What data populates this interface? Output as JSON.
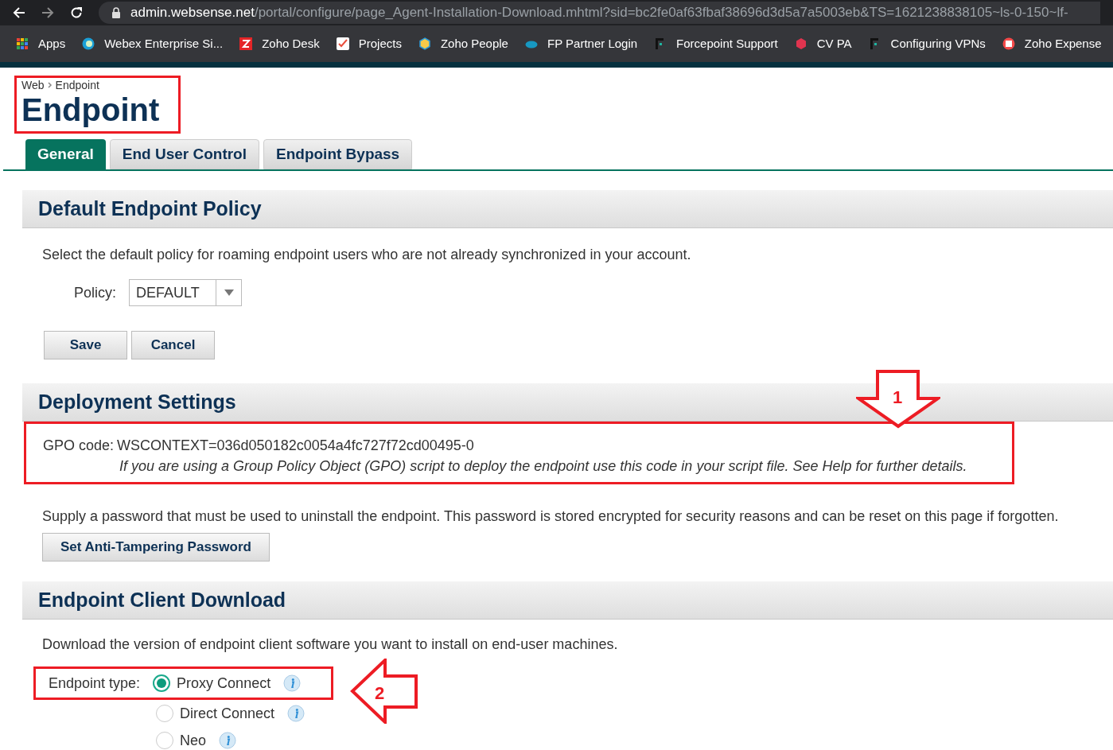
{
  "browser": {
    "url_host": "admin.websense.net",
    "url_path": "/portal/configure/page_Agent-Installation-Download.mhtml?sid=bc2fe0af63fbaf38696d3d5a7a5003eb&TS=1621238838105~ls-0-150~lf-",
    "bookmarks": [
      {
        "label": "Apps"
      },
      {
        "label": "Webex Enterprise Si..."
      },
      {
        "label": "Zoho Desk"
      },
      {
        "label": "Projects"
      },
      {
        "label": "Zoho People"
      },
      {
        "label": "FP Partner Login"
      },
      {
        "label": "Forcepoint Support"
      },
      {
        "label": "CV PA"
      },
      {
        "label": "Configuring VPNs"
      },
      {
        "label": "Zoho Expense"
      }
    ]
  },
  "breadcrumb": [
    "Web",
    "Endpoint"
  ],
  "title": "Endpoint",
  "tabs": [
    {
      "label": "General",
      "selected": true
    },
    {
      "label": "End User Control",
      "selected": false
    },
    {
      "label": "Endpoint Bypass",
      "selected": false
    }
  ],
  "policy_section": {
    "heading": "Default Endpoint Policy",
    "description": "Select the default policy for roaming endpoint users who are not already synchronized in your account.",
    "policy_label": "Policy:",
    "policy_value": "DEFAULT",
    "buttons": [
      "Save",
      "Cancel"
    ]
  },
  "deployment_section": {
    "heading": "Deployment Settings",
    "gpo_label": "GPO code:",
    "gpo_value": "WSCONTEXT=036d050182c0054a4fc727f72cd00495-0",
    "gpo_note": "If you are using a Group Policy Object (GPO) script to deploy the endpoint use this code in your script file. See Help for further details.",
    "password_text": "Supply a password that must be used to uninstall the endpoint. This password is stored encrypted for security reasons and can be reset on this page if forgotten.",
    "password_button": "Set Anti-Tampering Password"
  },
  "download_section": {
    "heading": "Endpoint Client Download",
    "description": "Download the version of endpoint client software you want to install on end-user machines.",
    "type_label": "Endpoint type:",
    "types": [
      {
        "label": "Proxy Connect",
        "selected": true
      },
      {
        "label": "Direct Connect",
        "selected": false
      },
      {
        "label": "Neo",
        "selected": false
      }
    ]
  },
  "annotations": [
    "1",
    "2"
  ]
}
